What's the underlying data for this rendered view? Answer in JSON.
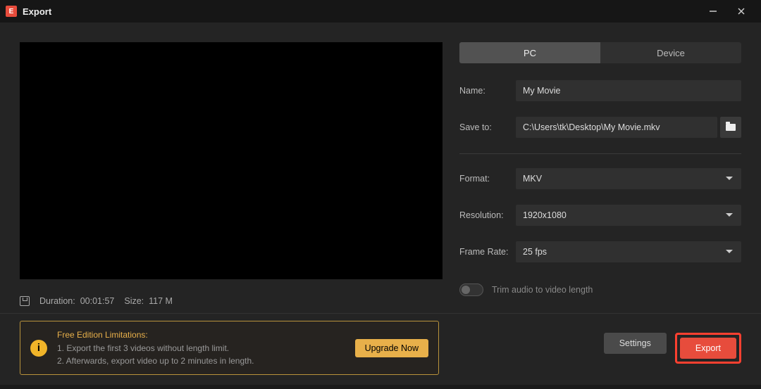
{
  "window": {
    "title": "Export",
    "icon_letter": "E"
  },
  "tabs": {
    "pc": "PC",
    "device": "Device"
  },
  "form": {
    "name_label": "Name:",
    "name_value": "My Movie",
    "save_label": "Save to:",
    "save_value": "C:\\Users\\tk\\Desktop\\My Movie.mkv",
    "format_label": "Format:",
    "format_value": "MKV",
    "resolution_label": "Resolution:",
    "resolution_value": "1920x1080",
    "framerate_label": "Frame Rate:",
    "framerate_value": "25 fps",
    "trim_label": "Trim audio to video length"
  },
  "info": {
    "duration_label": "Duration:",
    "duration_value": "00:01:57",
    "size_label": "Size:",
    "size_value": "117 M"
  },
  "promo": {
    "title": "Free Edition Limitations:",
    "line1": "1. Export the first 3 videos without length limit.",
    "line2": "2. Afterwards, export video up to 2 minutes in length.",
    "upgrade": "Upgrade Now"
  },
  "buttons": {
    "settings": "Settings",
    "export": "Export"
  }
}
